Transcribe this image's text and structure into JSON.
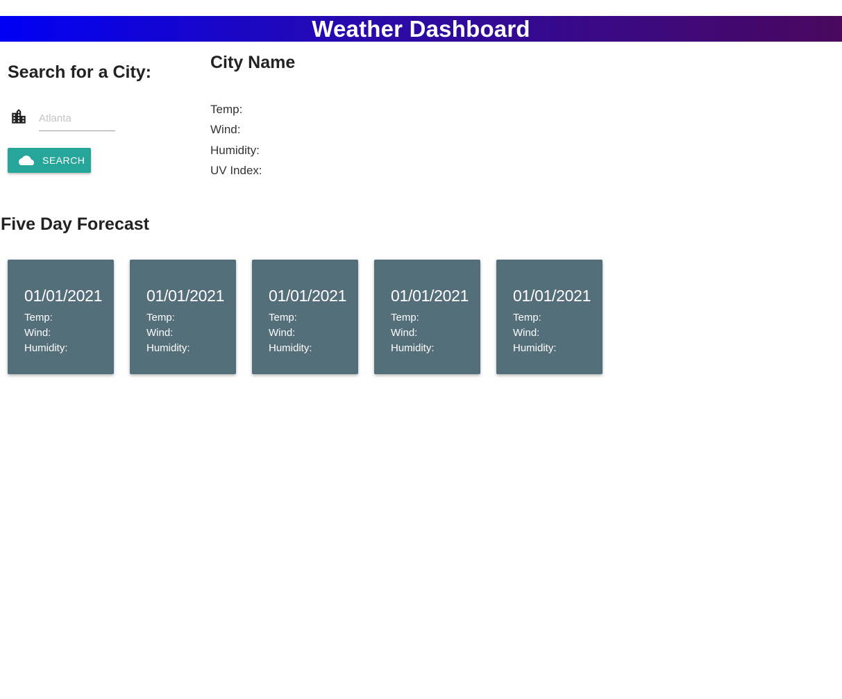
{
  "header": {
    "title": "Weather Dashboard"
  },
  "search": {
    "heading": "Search for a City:",
    "icon": "city-building-icon",
    "input_placeholder": "Atlanta",
    "input_value": "",
    "button_icon": "cloud-icon",
    "button_label": "SEARCH",
    "button_color": "#26a69a"
  },
  "current": {
    "city_name": "City Name",
    "temp_label": "Temp:",
    "wind_label": "Wind:",
    "humidity_label": "Humidity:",
    "uv_label": "UV Index:"
  },
  "forecast": {
    "heading": "Five Day Forecast",
    "card_color": "#546e7a",
    "cards": [
      {
        "date": "01/01/2021",
        "temp": "Temp:",
        "wind": "Wind:",
        "humidity": "Humidity:"
      },
      {
        "date": "01/01/2021",
        "temp": "Temp:",
        "wind": "Wind:",
        "humidity": "Humidity:"
      },
      {
        "date": "01/01/2021",
        "temp": "Temp:",
        "wind": "Wind:",
        "humidity": "Humidity:"
      },
      {
        "date": "01/01/2021",
        "temp": "Temp:",
        "wind": "Wind:",
        "humidity": "Humidity:"
      },
      {
        "date": "01/01/2021",
        "temp": "Temp:",
        "wind": "Wind:",
        "humidity": "Humidity:"
      }
    ]
  }
}
